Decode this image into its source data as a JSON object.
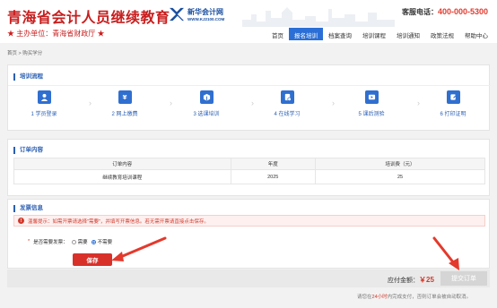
{
  "header": {
    "brand_title": "青海省会计人员继续教育",
    "brand_sub": "★ 主办单位：青海省财政厅 ★",
    "logo_cn": "新华会计网",
    "logo_url": "WWW.KJ2100.COM",
    "phone_label": "客服电话：",
    "phone_number": "400-000-5300",
    "nav": [
      {
        "label": "首页"
      },
      {
        "label": "报名培训"
      },
      {
        "label": "档案查询"
      },
      {
        "label": "培训课程"
      },
      {
        "label": "培训通知"
      },
      {
        "label": "政策法规"
      },
      {
        "label": "帮助中心"
      }
    ]
  },
  "breadcrumb": "首页 > 购买学分",
  "flow": {
    "title": "培训流程",
    "steps": [
      {
        "label": "1 学员登录",
        "icon": "user-icon"
      },
      {
        "label": "2 网上缴费",
        "icon": "yen-icon"
      },
      {
        "label": "3 选课培训",
        "icon": "box-icon"
      },
      {
        "label": "4 在线学习",
        "icon": "document-icon"
      },
      {
        "label": "5 课后测验",
        "icon": "video-icon"
      },
      {
        "label": "6 打印证明",
        "icon": "edit-icon"
      }
    ]
  },
  "order": {
    "title": "订单内容",
    "columns": [
      "订单内容",
      "年度",
      "培训费（元）"
    ],
    "rows": [
      {
        "content": "继续教育培训课程",
        "year": "2025",
        "fee": "25"
      }
    ]
  },
  "invoice": {
    "title": "发票信息",
    "tip": "温馨提示：如需开票请选择\"需要\"，并填写开票信息。若无需开票请直接点击保存。",
    "question": "是否需要发票：",
    "options": [
      "需要",
      "不需要"
    ],
    "selected": "不需要",
    "save_label": "保存"
  },
  "payment": {
    "amount_label": "应付金额：",
    "amount": "￥25",
    "submit_label": "提交订单",
    "note_prefix": "请您在",
    "note_highlight": "24小时",
    "note_suffix": "内完成支付，否则订单会被自动取消。"
  },
  "colors": {
    "brand_red": "#c81e1e",
    "nav_active": "#2b6fd6",
    "step_icon": "#2f6fd0",
    "save_button": "#d8312a",
    "submit_disabled": "#d5d5d5",
    "arrow": "#e4392c"
  }
}
